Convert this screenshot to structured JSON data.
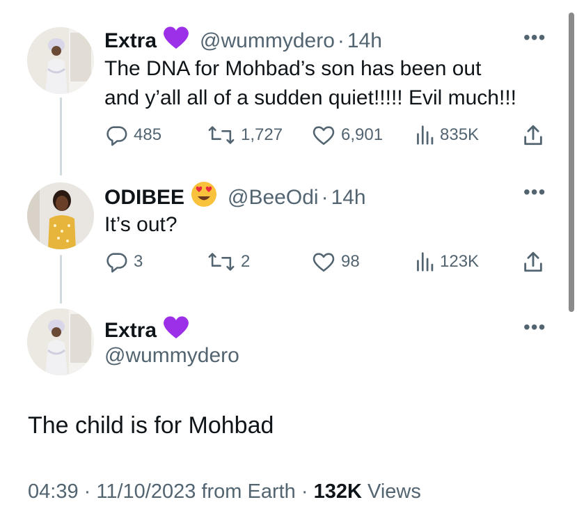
{
  "tweets": [
    {
      "display_name": "Extra",
      "handle": "@wummydero",
      "time": "14h",
      "text_lines": [
        "The DNA for Mohbad’s son has been out",
        "and y’all all of a sudden quiet!!!!! Evil much!!!"
      ],
      "replies": "485",
      "retweets": "1,727",
      "likes": "6,901",
      "views": "835K"
    },
    {
      "display_name": "ODIBEE",
      "handle": "@BeeOdi",
      "time": "14h",
      "text_lines": [
        "It’s out?"
      ],
      "replies": "3",
      "retweets": "2",
      "likes": "98",
      "views": "123K"
    }
  ],
  "main_tweet": {
    "display_name": "Extra",
    "handle": "@wummydero",
    "text": "The child is for Mohbad",
    "time": "04:39",
    "date": "11/10/2023",
    "source": "from Earth",
    "views_count": "132K",
    "views_label": "Views"
  },
  "separator": "·",
  "more_glyph": "•••",
  "colors": {
    "text": "#0f1419",
    "secondary": "#536471",
    "verified_heart": "#9b30e8",
    "thread_line": "#cfd9de"
  },
  "icons": [
    "purple-heart-icon",
    "heart-eyes-emoji-icon",
    "reply-icon",
    "retweet-icon",
    "like-icon",
    "views-icon",
    "share-icon",
    "more-icon"
  ]
}
